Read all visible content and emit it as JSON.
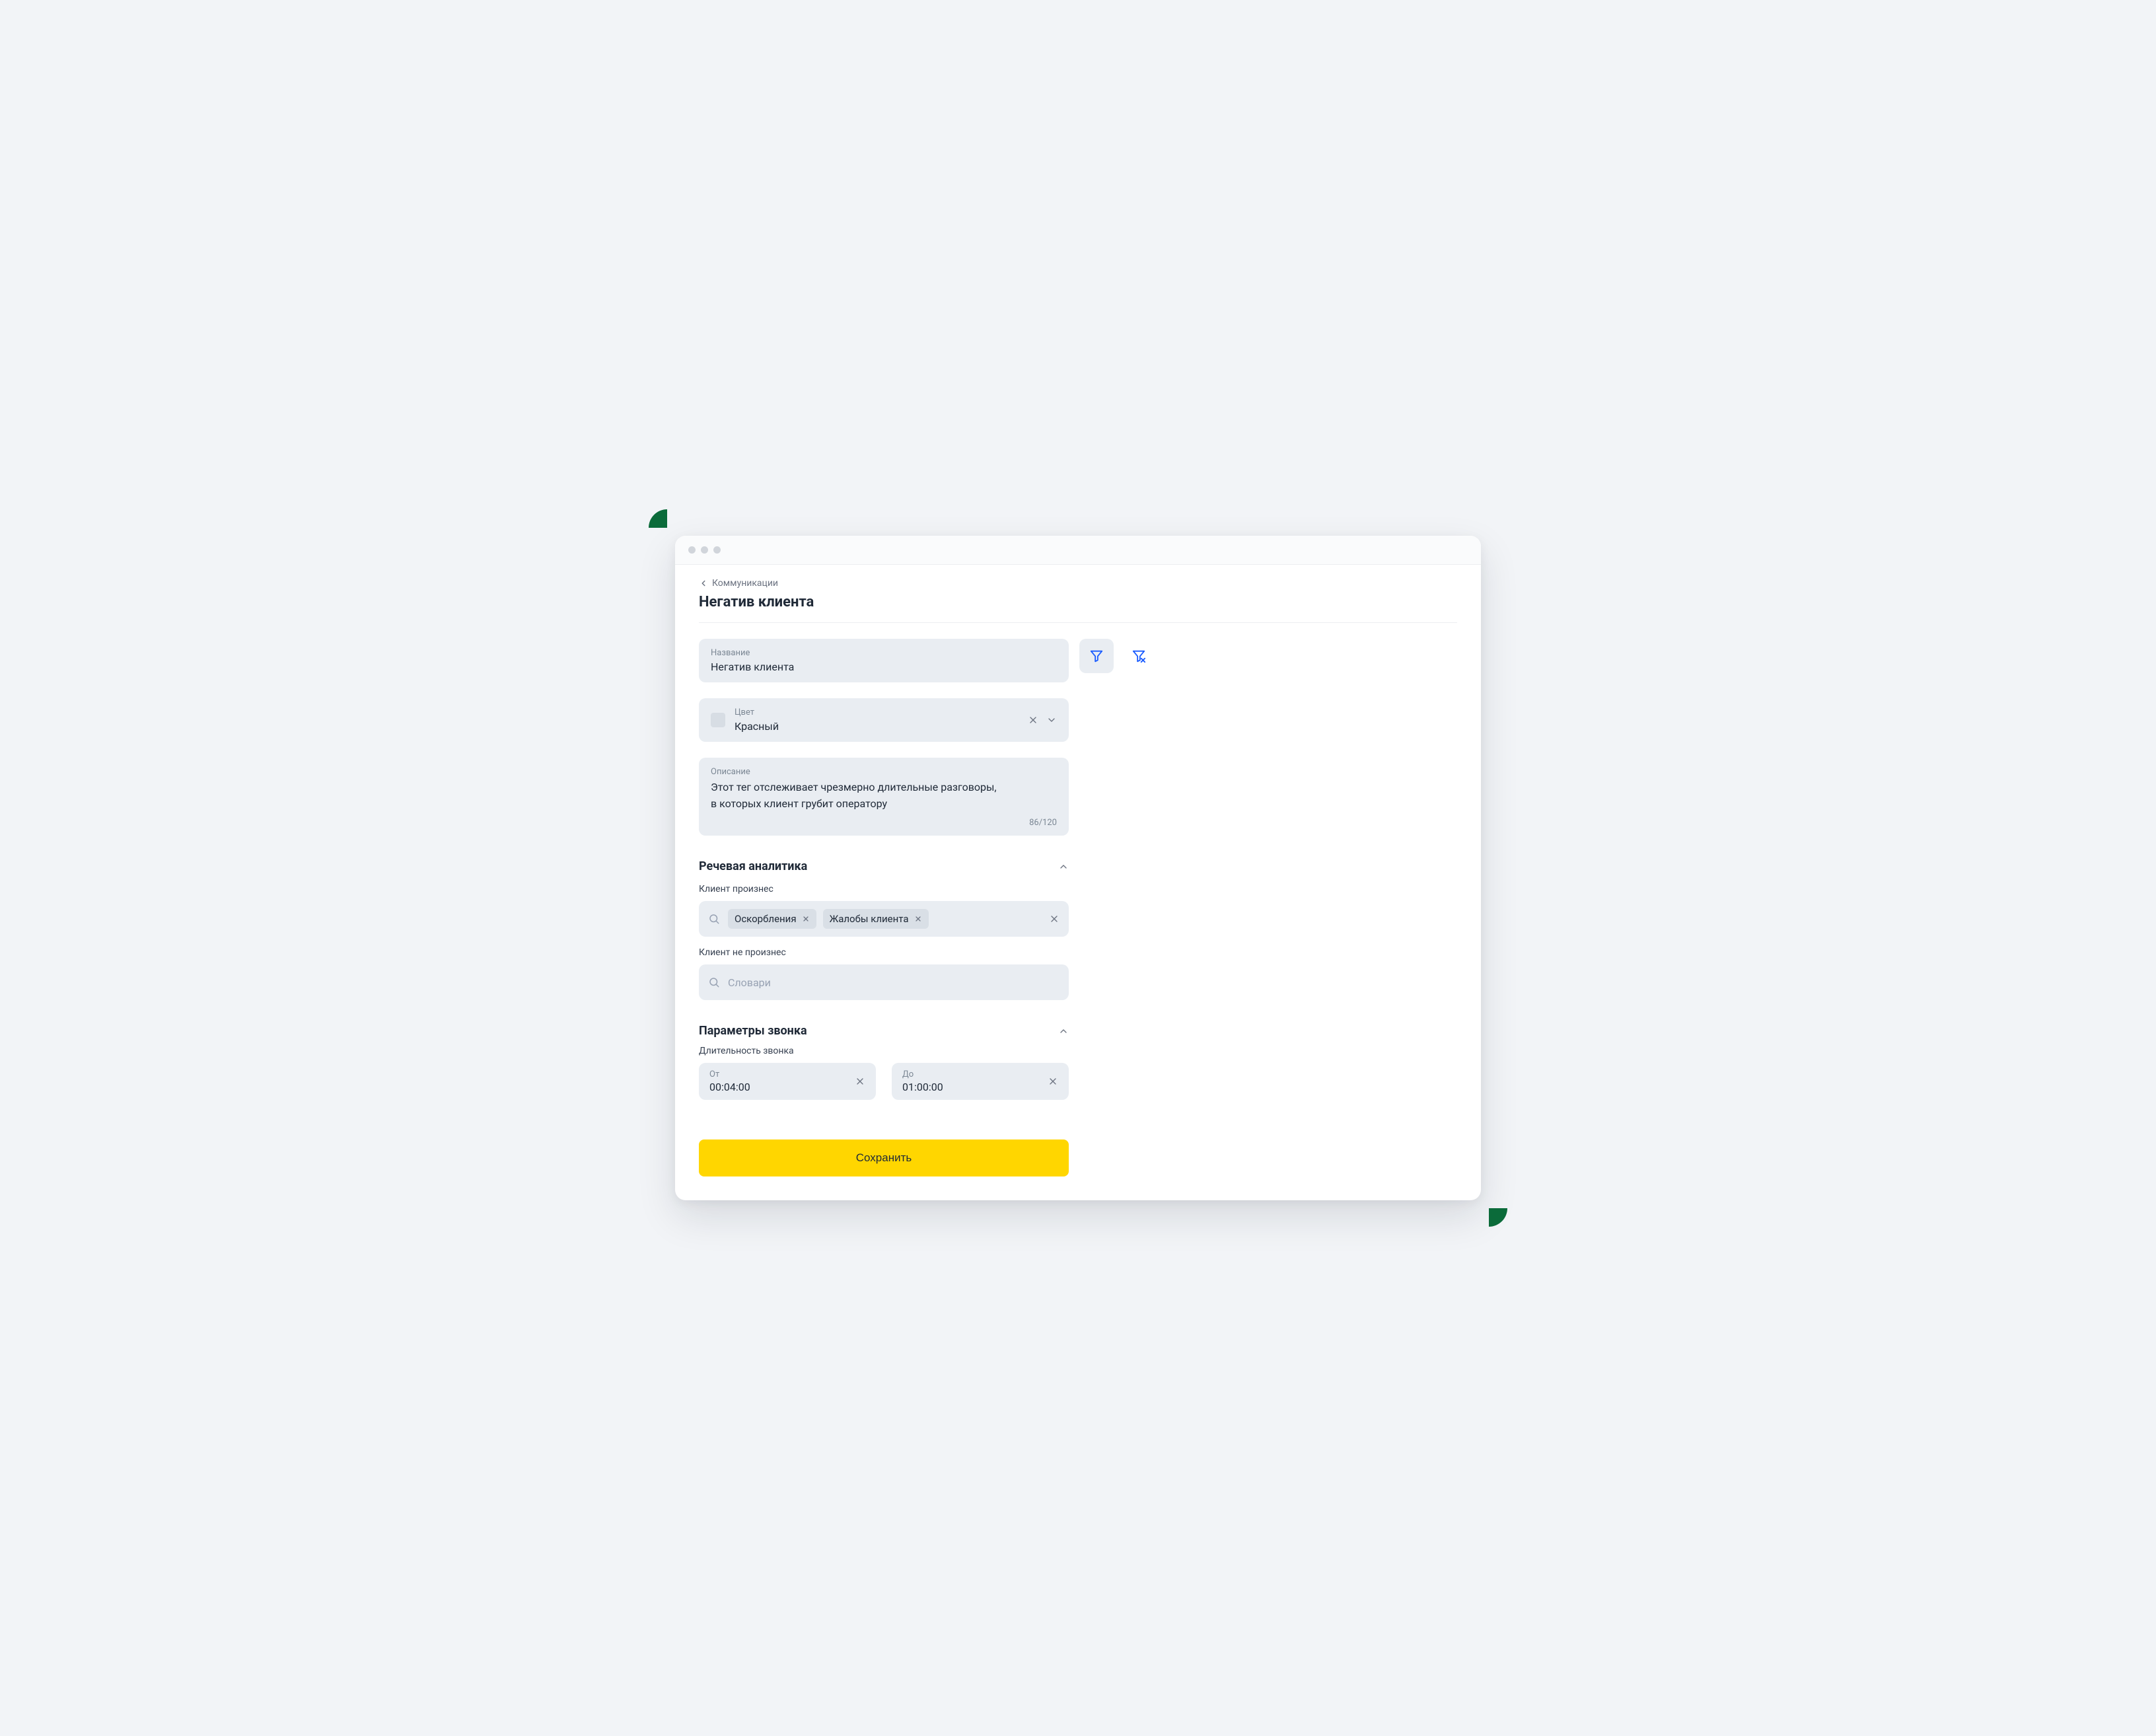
{
  "colors": {
    "accent_blue": "#1a5cff",
    "brand_yellow": "#ffd600"
  },
  "breadcrumb": {
    "label": "Коммуникации"
  },
  "page_title": "Негатив клиента",
  "name_field": {
    "label": "Название",
    "value": "Негатив клиента"
  },
  "color_field": {
    "label": "Цвет",
    "value": "Красный"
  },
  "description_field": {
    "label": "Описание",
    "value": "Этот тег отслеживает чрезмерно длительные разговоры,\nв которых клиент грубит оператору",
    "counter": "86/120"
  },
  "speech_section": {
    "title": "Речевая аналитика",
    "client_said_label": "Клиент произнес",
    "client_said_chips": [
      "Оскорбления",
      "Жалобы клиента"
    ],
    "client_not_said_label": "Клиент не произнес",
    "client_not_said_placeholder": "Словари"
  },
  "call_section": {
    "title": "Параметры звонка",
    "duration_label": "Длительность звонка",
    "from": {
      "label": "От",
      "value": "00:04:00"
    },
    "to": {
      "label": "До",
      "value": "01:00:00"
    }
  },
  "save_label": "Сохранить"
}
